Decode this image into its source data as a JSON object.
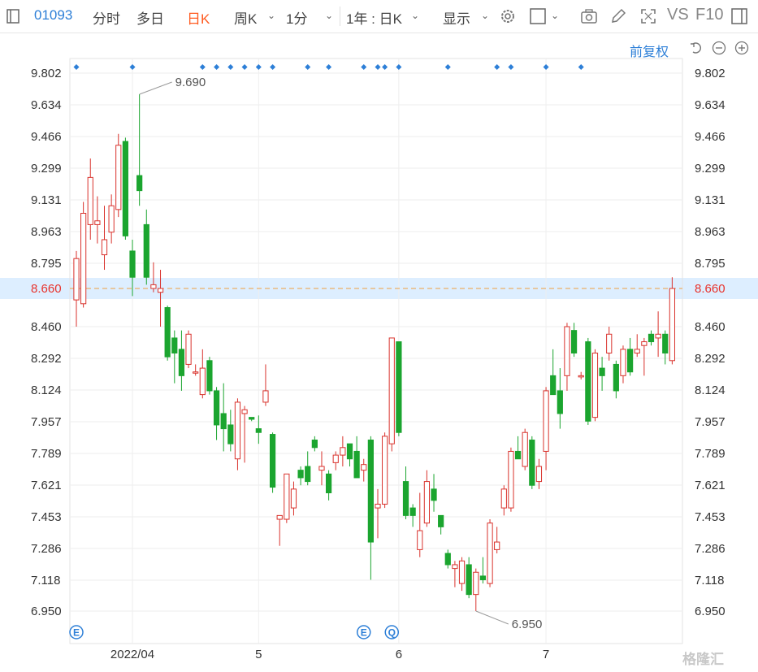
{
  "toolbar": {
    "code": "01093",
    "tabs": [
      "分时",
      "多日",
      "日K",
      "周K"
    ],
    "active_tab": "日K",
    "minute": "1分",
    "range": "1年 : 日K",
    "display": "显示",
    "vs": "VS",
    "f10": "F10"
  },
  "subbar": {
    "adjust": "前复权"
  },
  "colors": {
    "up": "#d9322c",
    "down": "#1ba52f",
    "accent": "#2d7fd7",
    "current": "#e8322b",
    "current_line": "#f0a040"
  },
  "watermark": "格隆汇",
  "chart_data": {
    "type": "candlestick",
    "y_ticks": [
      "9.802",
      "9.634",
      "9.466",
      "9.299",
      "9.131",
      "8.963",
      "8.795",
      "8.460",
      "8.292",
      "8.124",
      "7.957",
      "7.789",
      "7.621",
      "7.453",
      "7.286",
      "7.118",
      "6.950"
    ],
    "ylim": [
      6.95,
      9.802
    ],
    "current_price": "8.660",
    "x_labels": [
      {
        "label": "2022/04",
        "index": 8
      },
      {
        "label": "5",
        "index": 26
      },
      {
        "label": "6",
        "index": 46
      },
      {
        "label": "7",
        "index": 67
      }
    ],
    "high_annotation": {
      "label": "9.690",
      "index": 9,
      "value": 9.69
    },
    "low_annotation": {
      "label": "6.950",
      "index": 57,
      "value": 6.95
    },
    "event_markers_top": [
      0,
      8,
      18,
      20,
      22,
      24,
      26,
      28,
      33,
      36,
      41,
      43,
      44,
      46,
      53,
      60,
      62,
      67,
      72
    ],
    "event_markers_bottom": [
      {
        "index": 0,
        "label": "E"
      },
      {
        "index": 41,
        "label": "E"
      },
      {
        "index": 45,
        "label": "Q"
      }
    ],
    "candles": [
      {
        "o": 8.6,
        "h": 8.86,
        "l": 8.46,
        "c": 8.82
      },
      {
        "o": 8.58,
        "h": 9.12,
        "l": 8.56,
        "c": 9.06
      },
      {
        "o": 9.0,
        "h": 9.35,
        "l": 8.92,
        "c": 9.25
      },
      {
        "o": 9.0,
        "h": 9.15,
        "l": 8.9,
        "c": 9.02
      },
      {
        "o": 8.84,
        "h": 9.1,
        "l": 8.76,
        "c": 8.92
      },
      {
        "o": 8.96,
        "h": 9.16,
        "l": 8.9,
        "c": 9.1
      },
      {
        "o": 9.08,
        "h": 9.48,
        "l": 9.04,
        "c": 9.42
      },
      {
        "o": 9.44,
        "h": 9.46,
        "l": 8.92,
        "c": 8.94
      },
      {
        "o": 8.86,
        "h": 8.92,
        "l": 8.62,
        "c": 8.72
      },
      {
        "o": 9.26,
        "h": 9.69,
        "l": 9.1,
        "c": 9.18
      },
      {
        "o": 9.0,
        "h": 9.08,
        "l": 8.68,
        "c": 8.72
      },
      {
        "o": 8.66,
        "h": 8.8,
        "l": 8.64,
        "c": 8.68
      },
      {
        "o": 8.64,
        "h": 8.76,
        "l": 8.46,
        "c": 8.66
      },
      {
        "o": 8.56,
        "h": 8.57,
        "l": 8.28,
        "c": 8.3
      },
      {
        "o": 8.4,
        "h": 8.44,
        "l": 8.16,
        "c": 8.32
      },
      {
        "o": 8.34,
        "h": 8.44,
        "l": 8.12,
        "c": 8.2
      },
      {
        "o": 8.26,
        "h": 8.44,
        "l": 8.24,
        "c": 8.42
      },
      {
        "o": 8.22,
        "h": 8.26,
        "l": 8.2,
        "c": 8.22
      },
      {
        "o": 8.1,
        "h": 8.34,
        "l": 8.08,
        "c": 8.24
      },
      {
        "o": 8.28,
        "h": 8.3,
        "l": 8.1,
        "c": 8.12
      },
      {
        "o": 8.12,
        "h": 8.14,
        "l": 7.86,
        "c": 7.94
      },
      {
        "o": 8.0,
        "h": 8.16,
        "l": 7.8,
        "c": 7.92
      },
      {
        "o": 7.94,
        "h": 8.02,
        "l": 7.8,
        "c": 7.84
      },
      {
        "o": 7.76,
        "h": 8.08,
        "l": 7.7,
        "c": 8.06
      },
      {
        "o": 8.0,
        "h": 8.04,
        "l": 7.74,
        "c": 8.02
      },
      {
        "o": 7.98,
        "h": 7.98,
        "l": 7.96,
        "c": 7.97
      },
      {
        "o": 7.92,
        "h": 7.99,
        "l": 7.84,
        "c": 7.9
      },
      {
        "o": 8.06,
        "h": 8.26,
        "l": 8.04,
        "c": 8.12
      },
      {
        "o": 7.89,
        "h": 7.9,
        "l": 7.58,
        "c": 7.61
      },
      {
        "o": 7.44,
        "h": 7.46,
        "l": 7.3,
        "c": 7.46
      },
      {
        "o": 7.44,
        "h": 7.68,
        "l": 7.42,
        "c": 7.68
      },
      {
        "o": 7.5,
        "h": 7.64,
        "l": 7.46,
        "c": 7.6
      },
      {
        "o": 7.7,
        "h": 7.72,
        "l": 7.62,
        "c": 7.66
      },
      {
        "o": 7.72,
        "h": 7.8,
        "l": 7.62,
        "c": 7.64
      },
      {
        "o": 7.86,
        "h": 7.88,
        "l": 7.8,
        "c": 7.82
      },
      {
        "o": 7.7,
        "h": 7.8,
        "l": 7.62,
        "c": 7.72
      },
      {
        "o": 7.68,
        "h": 7.7,
        "l": 7.54,
        "c": 7.58
      },
      {
        "o": 7.74,
        "h": 7.8,
        "l": 7.7,
        "c": 7.78
      },
      {
        "o": 7.78,
        "h": 7.88,
        "l": 7.72,
        "c": 7.82
      },
      {
        "o": 7.84,
        "h": 7.84,
        "l": 7.72,
        "c": 7.76
      },
      {
        "o": 7.8,
        "h": 7.88,
        "l": 7.72,
        "c": 7.66
      },
      {
        "o": 7.7,
        "h": 7.76,
        "l": 7.64,
        "c": 7.73
      },
      {
        "o": 7.86,
        "h": 7.88,
        "l": 7.12,
        "c": 7.32
      },
      {
        "o": 7.5,
        "h": 7.6,
        "l": 7.34,
        "c": 7.52
      },
      {
        "o": 7.52,
        "h": 7.9,
        "l": 7.5,
        "c": 7.88
      },
      {
        "o": 7.84,
        "h": 8.4,
        "l": 7.8,
        "c": 8.4
      },
      {
        "o": 8.38,
        "h": 8.38,
        "l": 7.88,
        "c": 7.9
      },
      {
        "o": 7.64,
        "h": 7.72,
        "l": 7.44,
        "c": 7.46
      },
      {
        "o": 7.5,
        "h": 7.52,
        "l": 7.4,
        "c": 7.46
      },
      {
        "o": 7.28,
        "h": 7.58,
        "l": 7.24,
        "c": 7.38
      },
      {
        "o": 7.42,
        "h": 7.7,
        "l": 7.4,
        "c": 7.64
      },
      {
        "o": 7.6,
        "h": 7.68,
        "l": 7.48,
        "c": 7.54
      },
      {
        "o": 7.46,
        "h": 7.46,
        "l": 7.36,
        "c": 7.4
      },
      {
        "o": 7.26,
        "h": 7.28,
        "l": 7.18,
        "c": 7.2
      },
      {
        "o": 7.18,
        "h": 7.22,
        "l": 7.08,
        "c": 7.2
      },
      {
        "o": 7.1,
        "h": 7.24,
        "l": 7.06,
        "c": 7.22
      },
      {
        "o": 7.2,
        "h": 7.24,
        "l": 7.02,
        "c": 7.04
      },
      {
        "o": 7.04,
        "h": 7.18,
        "l": 6.95,
        "c": 7.16
      },
      {
        "o": 7.14,
        "h": 7.24,
        "l": 7.1,
        "c": 7.12
      },
      {
        "o": 7.1,
        "h": 7.44,
        "l": 7.08,
        "c": 7.42
      },
      {
        "o": 7.28,
        "h": 7.4,
        "l": 7.26,
        "c": 7.32
      },
      {
        "o": 7.5,
        "h": 7.62,
        "l": 7.46,
        "c": 7.6
      },
      {
        "o": 7.5,
        "h": 7.82,
        "l": 7.48,
        "c": 7.8
      },
      {
        "o": 7.8,
        "h": 7.88,
        "l": 7.78,
        "c": 7.76
      },
      {
        "o": 7.72,
        "h": 7.92,
        "l": 7.7,
        "c": 7.9
      },
      {
        "o": 7.86,
        "h": 7.88,
        "l": 7.6,
        "c": 7.62
      },
      {
        "o": 7.64,
        "h": 7.76,
        "l": 7.6,
        "c": 7.72
      },
      {
        "o": 7.8,
        "h": 8.14,
        "l": 7.7,
        "c": 8.12
      },
      {
        "o": 8.2,
        "h": 8.34,
        "l": 8.1,
        "c": 8.1
      },
      {
        "o": 8.12,
        "h": 8.24,
        "l": 7.92,
        "c": 8.0
      },
      {
        "o": 8.2,
        "h": 8.48,
        "l": 8.12,
        "c": 8.46
      },
      {
        "o": 8.44,
        "h": 8.48,
        "l": 8.3,
        "c": 8.32
      },
      {
        "o": 8.2,
        "h": 8.22,
        "l": 8.18,
        "c": 8.2
      },
      {
        "o": 8.38,
        "h": 8.4,
        "l": 7.94,
        "c": 7.96
      },
      {
        "o": 7.98,
        "h": 8.34,
        "l": 7.96,
        "c": 8.32
      },
      {
        "o": 8.24,
        "h": 8.3,
        "l": 8.12,
        "c": 8.2
      },
      {
        "o": 8.32,
        "h": 8.46,
        "l": 8.28,
        "c": 8.42
      },
      {
        "o": 8.26,
        "h": 8.28,
        "l": 8.08,
        "c": 8.12
      },
      {
        "o": 8.2,
        "h": 8.36,
        "l": 8.16,
        "c": 8.34
      },
      {
        "o": 8.34,
        "h": 8.4,
        "l": 8.2,
        "c": 8.22
      },
      {
        "o": 8.32,
        "h": 8.42,
        "l": 8.3,
        "c": 8.34
      },
      {
        "o": 8.36,
        "h": 8.4,
        "l": 8.2,
        "c": 8.38
      },
      {
        "o": 8.42,
        "h": 8.44,
        "l": 8.36,
        "c": 8.38
      },
      {
        "o": 8.4,
        "h": 8.54,
        "l": 8.3,
        "c": 8.42
      },
      {
        "o": 8.42,
        "h": 8.44,
        "l": 8.26,
        "c": 8.32
      },
      {
        "o": 8.28,
        "h": 8.72,
        "l": 8.26,
        "c": 8.66
      }
    ]
  }
}
